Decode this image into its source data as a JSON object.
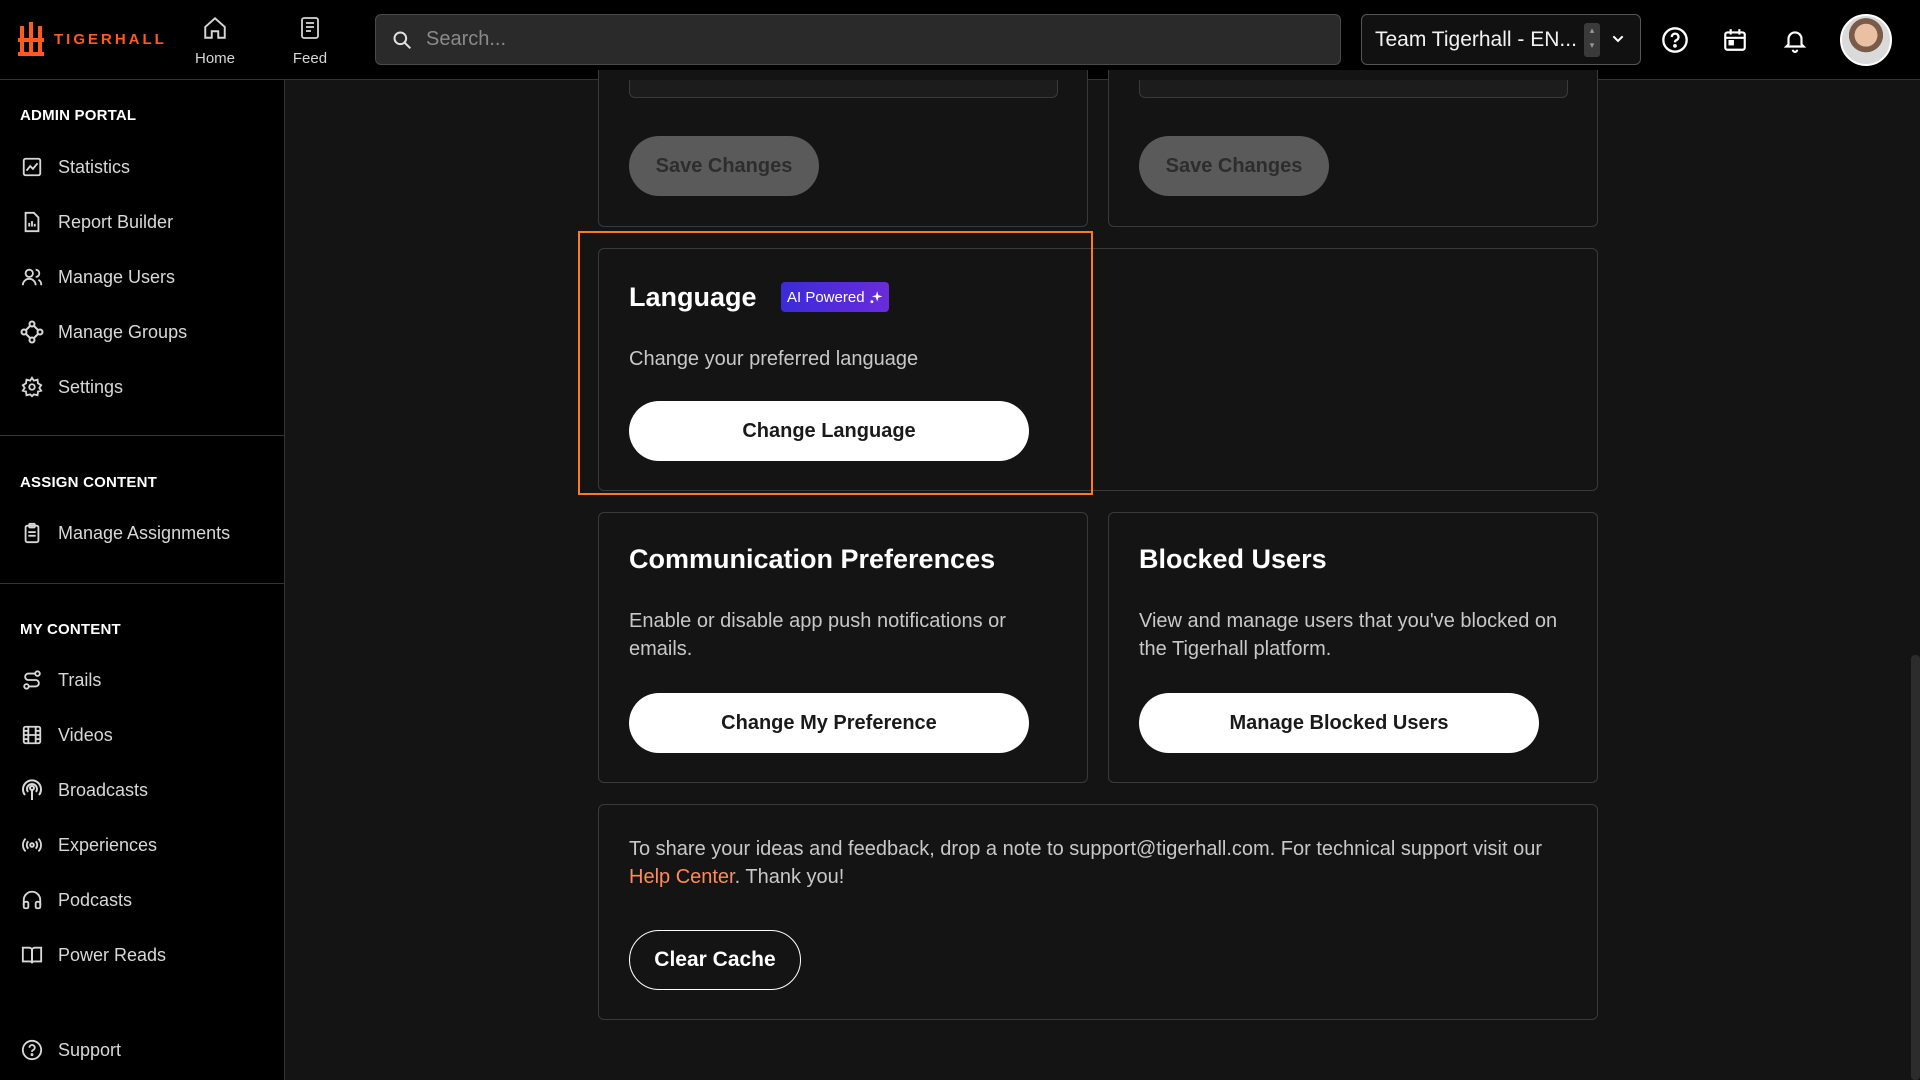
{
  "app": {
    "logo_text": "TIGERHALL"
  },
  "topbar": {
    "nav": [
      {
        "label": "Home",
        "icon": "home-icon"
      },
      {
        "label": "Feed",
        "icon": "feed-icon"
      }
    ],
    "search": {
      "placeholder": "Search..."
    },
    "team_selector": {
      "value": "Team Tigerhall - EN..."
    },
    "icons": [
      "help-icon",
      "calendar-icon",
      "bell-icon"
    ]
  },
  "sidebar": {
    "admin_portal": {
      "title": "ADMIN PORTAL",
      "items": [
        {
          "label": "Statistics",
          "icon": "chart-icon"
        },
        {
          "label": "Report Builder",
          "icon": "report-icon"
        },
        {
          "label": "Manage Users",
          "icon": "users-icon"
        },
        {
          "label": "Manage Groups",
          "icon": "groups-icon"
        },
        {
          "label": "Settings",
          "icon": "gear-icon"
        }
      ]
    },
    "assign_content": {
      "title": "ASSIGN CONTENT",
      "items": [
        {
          "label": "Manage Assignments",
          "icon": "clipboard-icon"
        }
      ]
    },
    "my_content": {
      "title": "MY CONTENT",
      "items": [
        {
          "label": "Trails",
          "icon": "trail-icon"
        },
        {
          "label": "Videos",
          "icon": "film-icon"
        },
        {
          "label": "Broadcasts",
          "icon": "broadcast-icon"
        },
        {
          "label": "Experiences",
          "icon": "signal-icon"
        },
        {
          "label": "Podcasts",
          "icon": "headphones-icon"
        },
        {
          "label": "Power Reads",
          "icon": "book-icon"
        }
      ]
    },
    "support": {
      "label": "Support",
      "icon": "help-icon"
    }
  },
  "main": {
    "top_cards": {
      "save_label_left": "Save Changes",
      "save_label_right": "Save Changes"
    },
    "language": {
      "title": "Language",
      "badge": "AI Powered",
      "description": "Change your preferred language",
      "button": "Change Language"
    },
    "communication": {
      "title": "Communication Preferences",
      "description": "Enable or disable app push notifications or emails.",
      "button": "Change My Preference"
    },
    "blocked": {
      "title": "Blocked Users",
      "description": "View and manage users that you've blocked on the Tigerhall platform.",
      "button": "Manage Blocked Users"
    },
    "feedback": {
      "text_before": "To share your ideas and feedback, drop a note to support@tigerhall.com. For technical support visit our ",
      "link": "Help Center",
      "text_after": ". Thank you!",
      "button": "Clear Cache"
    }
  },
  "colors": {
    "accent": "#ff5a1f",
    "highlight": "#ff7a1a",
    "link": "#ff8a5a",
    "ai_badge": "#4b2bdb"
  }
}
